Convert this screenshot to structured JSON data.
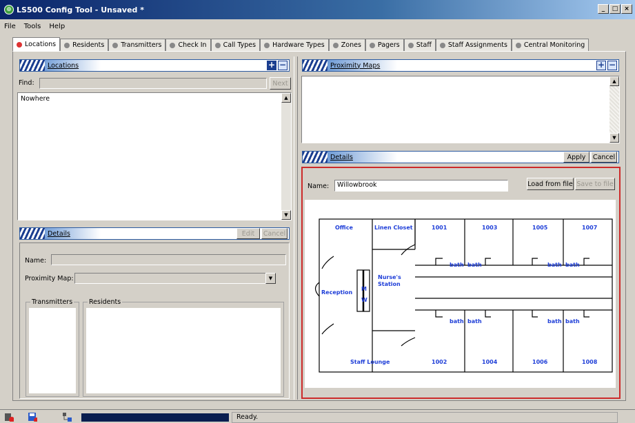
{
  "window": {
    "title": "LS500 Config Tool - Unsaved *"
  },
  "menu": [
    "File",
    "Tools",
    "Help"
  ],
  "tabs": [
    "Locations",
    "Residents",
    "Transmitters",
    "Check In",
    "Call Types",
    "Hardware Types",
    "Zones",
    "Pagers",
    "Staff",
    "Staff Assignments",
    "Central Monitoring"
  ],
  "locations_panel": {
    "title": "Locations",
    "find_label": "Find:",
    "find_value": "",
    "next_label": "Next",
    "items": [
      "Nowhere"
    ]
  },
  "left_details": {
    "title": "Details",
    "edit_label": "Edit",
    "cancel_label": "Cancel",
    "name_label": "Name:",
    "name_value": "",
    "proximity_label": "Proximity Map:",
    "proximity_value": "",
    "transmitters_label": "Transmitters",
    "residents_label": "Residents"
  },
  "proximity_panel": {
    "title": "Proximity Maps",
    "items": []
  },
  "right_details": {
    "title": "Details",
    "apply_label": "Apply",
    "cancel_label": "Cancel",
    "name_label": "Name:",
    "name_value": "Willowbrook",
    "load_label": "Load from file",
    "save_label": "Save to file"
  },
  "floorplan": {
    "office": "Office",
    "linen": "Linen Closet",
    "reception": "Reception",
    "nurse_1": "Nurse's",
    "nurse_2": "Station",
    "m": "M",
    "w": "W",
    "staff_lounge": "Staff Lounge",
    "top_rooms": [
      "1001",
      "1003",
      "1005",
      "1007"
    ],
    "bottom_rooms": [
      "1002",
      "1004",
      "1006",
      "1008"
    ],
    "bath": "bath",
    "text_color": "#1e3ed8"
  },
  "status": {
    "text": "Ready."
  }
}
